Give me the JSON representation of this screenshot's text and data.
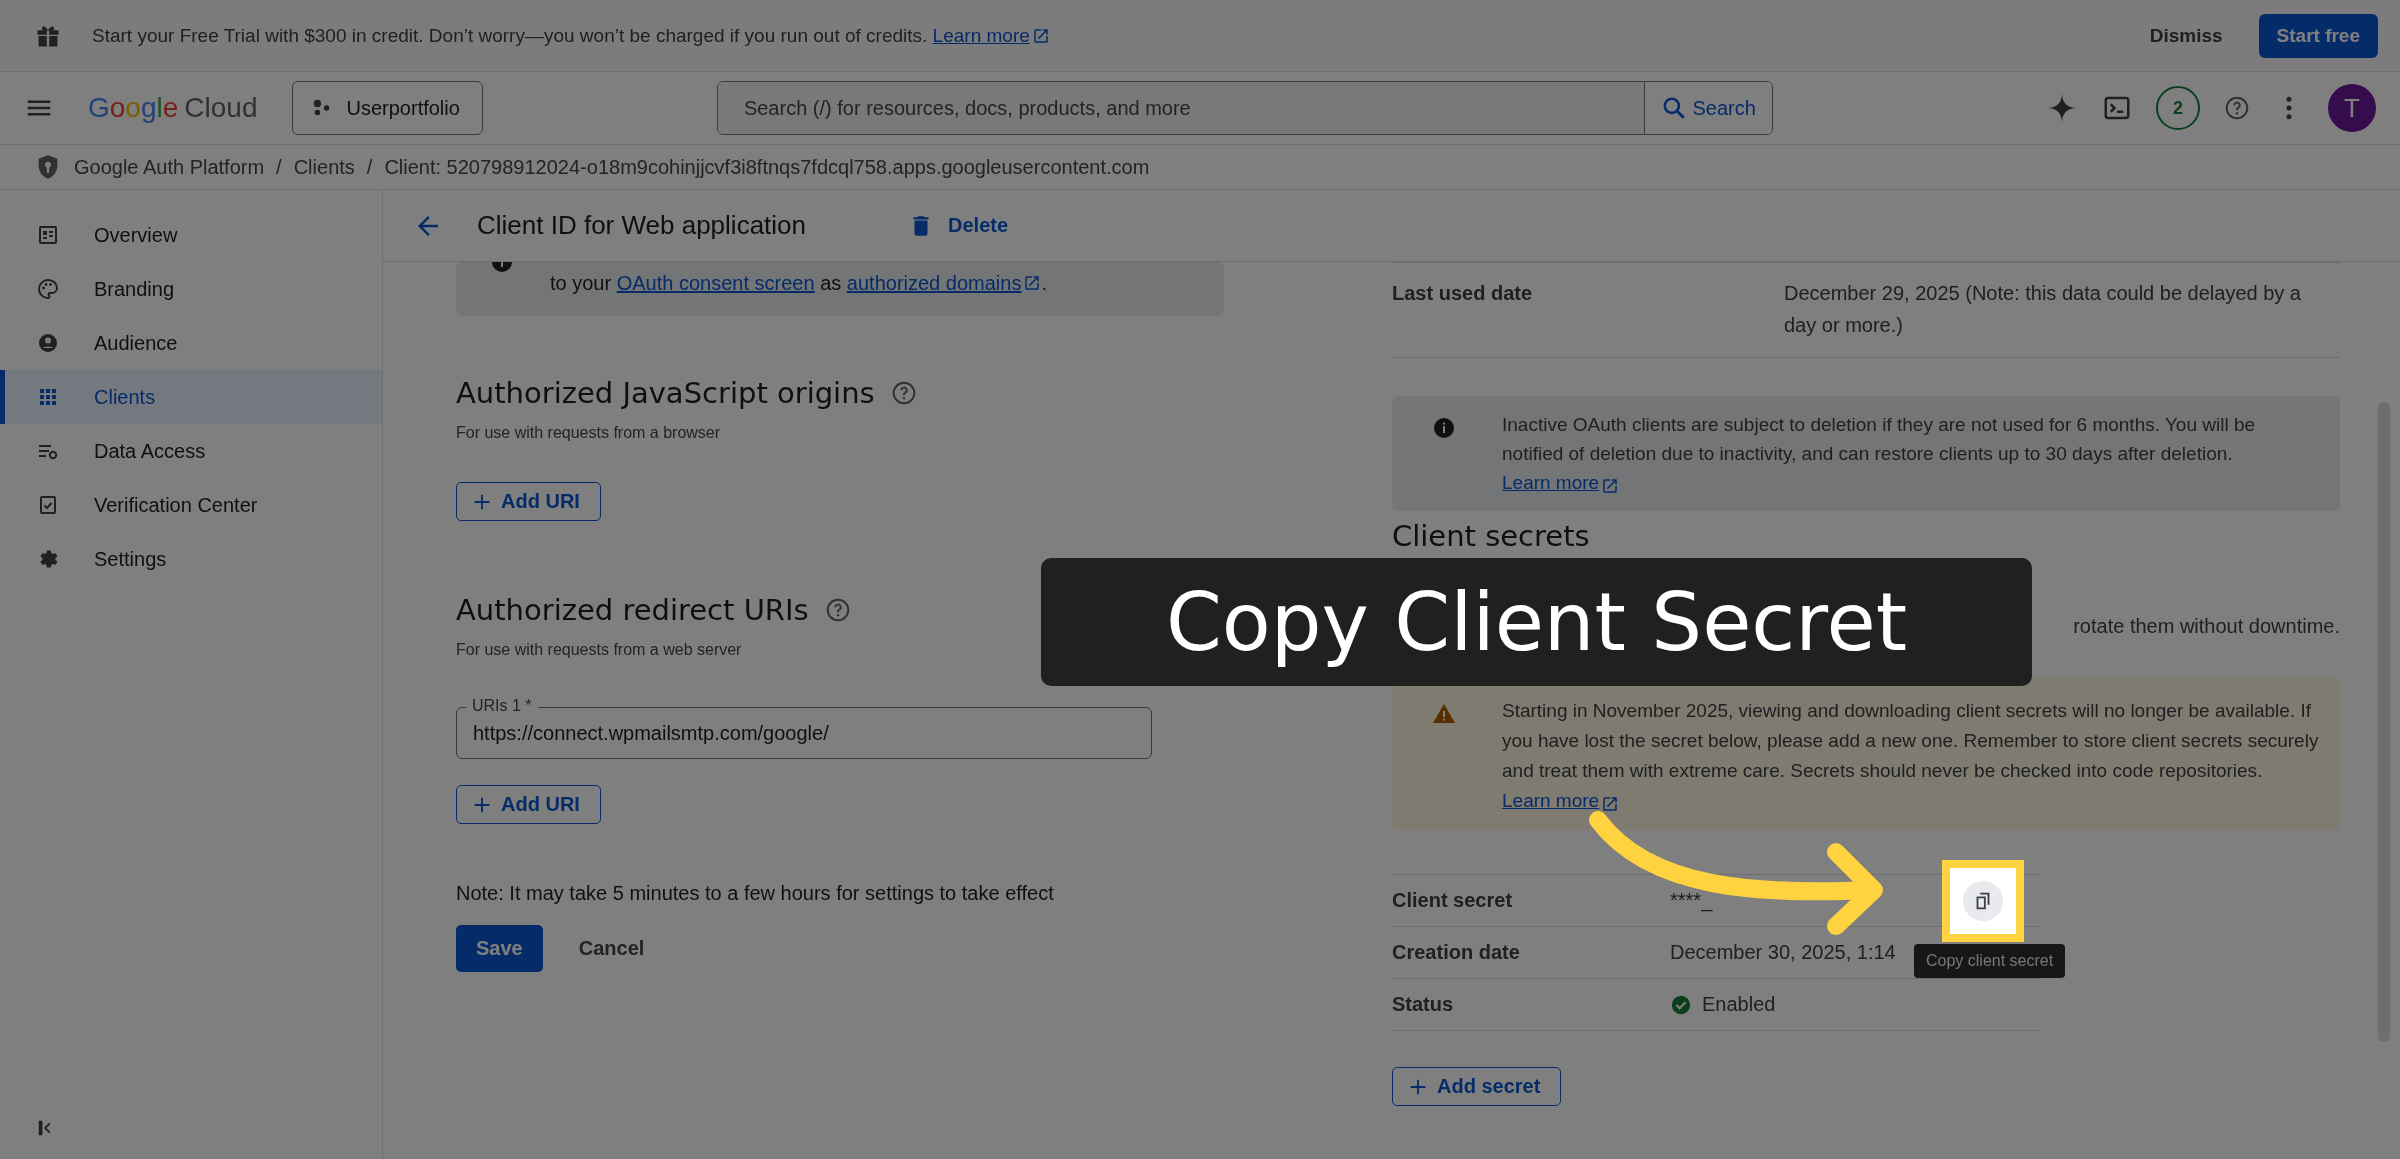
{
  "banner": {
    "text": "Start your Free Trial with $300 in credit. Don’t worry—you won’t be charged if you run out of credits.",
    "link": "Learn more",
    "dismiss": "Dismiss",
    "cta": "Start free"
  },
  "header": {
    "logo_word": "Google",
    "logo_product": "Cloud",
    "project": "Userportfolio",
    "search_placeholder": "Search (/) for resources, docs, products, and more",
    "search_button": "Search",
    "notifications": "2",
    "avatar": "T"
  },
  "breadcrumb": [
    "Google Auth Platform",
    "Clients",
    "Client: 520798912024-o18m9cohinjjcvf3i8ftnqs7fdcql758.apps.googleusercontent.com"
  ],
  "breadcrumb_separator": "/",
  "sidebar": {
    "items": [
      {
        "label": "Overview",
        "selected": false
      },
      {
        "label": "Branding",
        "selected": false
      },
      {
        "label": "Audience",
        "selected": false
      },
      {
        "label": "Clients",
        "selected": true
      },
      {
        "label": "Data Access",
        "selected": false
      },
      {
        "label": "Verification Center",
        "selected": false
      },
      {
        "label": "Settings",
        "selected": false
      }
    ]
  },
  "page": {
    "title": "Client ID for Web application",
    "delete": "Delete"
  },
  "left": {
    "info": [
      {
        "kind": "text",
        "text": "to your "
      },
      {
        "kind": "link",
        "text": "OAuth consent screen"
      },
      {
        "kind": "text",
        "text": " as "
      },
      {
        "kind": "external",
        "text": "authorized domains"
      },
      {
        "kind": "text",
        "text": "."
      }
    ],
    "origins": {
      "heading": "Authorized JavaScript origins",
      "hint": "For use with requests from a browser",
      "add": "Add URI"
    },
    "redirects": {
      "heading": "Authorized redirect URIs",
      "hint": "For use with requests from a web server",
      "field_label": "URIs 1 *",
      "field_value": "https://connect.wpmailsmtp.com/google/",
      "add": "Add URI"
    },
    "note": "Note: It may take 5 minutes to a few hours for settings to take effect",
    "save": "Save",
    "cancel": "Cancel"
  },
  "right": {
    "last_used": {
      "label": "Last used date",
      "value": "December 29, 2025 (Note: this data could be delayed by a day or more.)"
    },
    "info": {
      "text": "Inactive OAuth clients are subject to deletion if they are not used for 6 months. You will be notified of deletion due to inactivity, and can restore clients up to 30 days after deletion.",
      "link": "Learn more"
    },
    "secrets_heading": "Client secrets",
    "secrets_desc": "rotate them without downtime.",
    "warning": {
      "text": "Starting in November 2025, viewing and downloading client secrets will no longer be available. If you have lost the secret below, please add a new one. Remember to store client secrets securely and treat them with extreme care. Secrets should never be checked into code repositories.",
      "link": "Learn more"
    },
    "rows": [
      {
        "kind": "secret",
        "label": "Client secret",
        "value": "****_"
      },
      {
        "kind": "text",
        "label": "Creation date",
        "value": "December 30, 2025, 1:14"
      },
      {
        "kind": "status",
        "label": "Status",
        "value": "Enabled"
      }
    ],
    "tooltip": "Copy client secret",
    "add_secret": "Add secret"
  },
  "caption": "Copy Client Secret"
}
